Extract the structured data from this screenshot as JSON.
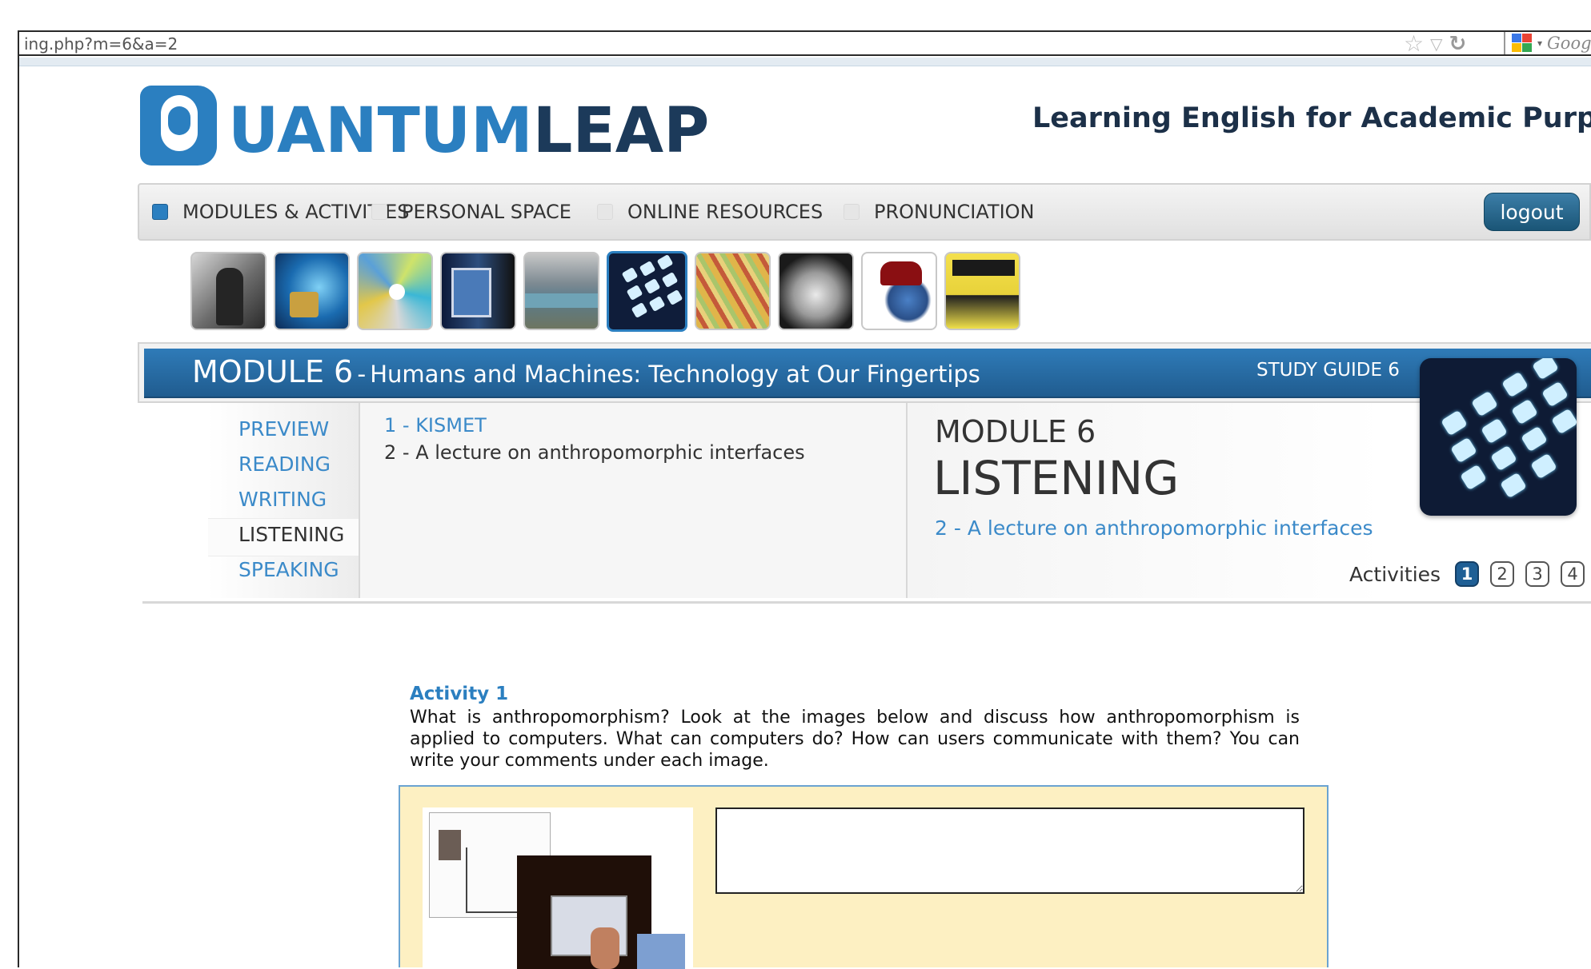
{
  "browser": {
    "url": "ing.php?m=6&a=2",
    "search_placeholder": "Google",
    "icons": [
      "star-icon",
      "dropdown-arrow-icon",
      "reload-icon",
      "google-icon"
    ]
  },
  "header": {
    "logo_part1": "UANTUM",
    "logo_part2": "LEAP",
    "tagline": "Learning English for Academic Purposes"
  },
  "nav": {
    "items": [
      {
        "label": "MODULES & ACTIVITIES",
        "active": true
      },
      {
        "label": "PERSONAL SPACE",
        "active": false
      },
      {
        "label": "ONLINE RESOURCES",
        "active": false
      },
      {
        "label": "PRONUNCIATION",
        "active": false
      }
    ],
    "logout_label": "logout"
  },
  "module_thumbnails": {
    "count": 10,
    "active_index": 6
  },
  "banner": {
    "module_number": "MODULE 6",
    "separator": "-",
    "module_subtitle": "Humans and Machines: Technology at Our Fingertips",
    "study_guide": "STUDY GUIDE 6"
  },
  "side_menu": {
    "items": [
      {
        "label": "PREVIEW",
        "current": false
      },
      {
        "label": "READING",
        "current": false
      },
      {
        "label": "WRITING",
        "current": false
      },
      {
        "label": "LISTENING",
        "current": true
      },
      {
        "label": "SPEAKING",
        "current": false
      }
    ]
  },
  "activity_list": {
    "items": [
      {
        "label": "1 - KISMET",
        "selected": false
      },
      {
        "label": "2 - A lecture on anthropomorphic interfaces",
        "selected": true
      }
    ]
  },
  "detail": {
    "module": "MODULE 6",
    "section": "LISTENING",
    "link": "2 - A lecture on anthropomorphic interfaces",
    "activities_label": "Activities",
    "activity_numbers": [
      "1",
      "2",
      "3",
      "4"
    ],
    "current_activity": "1"
  },
  "activity": {
    "heading": "Activity 1",
    "instructions": "What is anthropomorphism? Look at the images below and discuss how anthropomorphism is applied to computers. What can computers do? How can users communicate with them? You can write your comments under each image.",
    "comment_value": ""
  },
  "colors": {
    "brand_blue": "#2b7fc0",
    "brand_navy": "#1c3a5a",
    "exercise_bg": "#fdf0c2",
    "link_blue": "#3b8ac9"
  }
}
